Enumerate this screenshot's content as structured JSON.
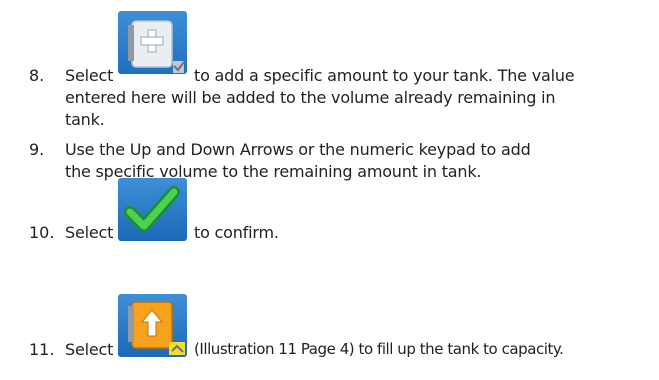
{
  "steps": [
    {
      "number": "8.",
      "lines": [
        "Select",
        "to add a specific amount to your tank. The value",
        "entered here will be added to the volume already remaining in",
        "tank."
      ],
      "icon": "tank-add-volume-icon"
    },
    {
      "number": "9.",
      "lines": [
        "Use the Up and Down Arrows or the numeric keypad to add",
        "the specific volume to the remaining amount in tank."
      ]
    },
    {
      "number": "10.",
      "lines": [
        "Select",
        "to confirm."
      ],
      "icon": "checkmark-confirm-icon"
    },
    {
      "number": "11.",
      "lines": [
        "Select",
        "(Illustration 11 Page 4) to fill up the tank to capacity."
      ],
      "icon": "tank-fill-up-icon"
    }
  ]
}
